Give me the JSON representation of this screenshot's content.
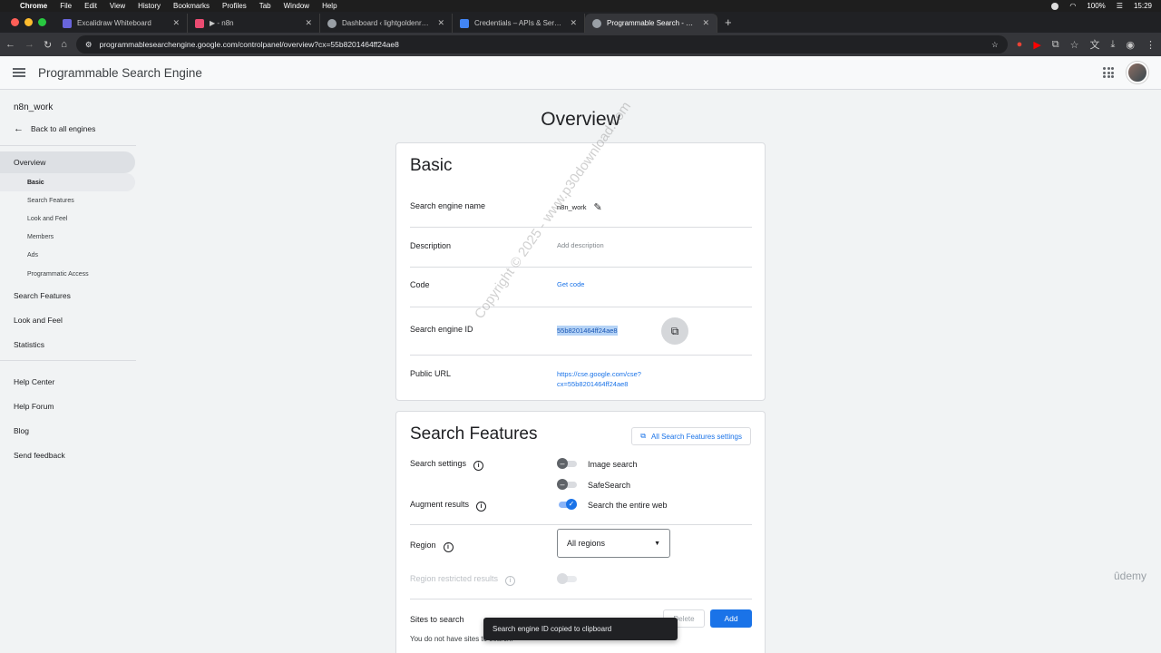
{
  "mac_menu": {
    "app": "Chrome",
    "items": [
      "File",
      "Edit",
      "View",
      "History",
      "Bookmarks",
      "Profiles",
      "Tab",
      "Window",
      "Help"
    ],
    "battery": "100%",
    "clock": "15:29"
  },
  "browser": {
    "tabs": [
      {
        "title": "Excalidraw Whiteboard",
        "favicon_color": "#6965db"
      },
      {
        "title": "▶ - n8n",
        "favicon_color": "#ea4b71"
      },
      {
        "title": "Dashboard ‹ lightgoldenrodye",
        "favicon_color": "#9aa0a6"
      },
      {
        "title": "Credentials – APIs & Services",
        "favicon_color": "#4285f4"
      },
      {
        "title": "Programmable Search - Overv",
        "favicon_color": "#9aa0a6"
      }
    ],
    "url": "programmablesearchengine.google.com/controlpanel/overview?cx=55b8201464ff24ae8"
  },
  "app": {
    "title": "Programmable Search Engine"
  },
  "sidebar": {
    "engine_name": "n8n_work",
    "back_label": "Back to all engines",
    "overview_label": "Overview",
    "sub_items": [
      "Basic",
      "Search Features",
      "Look and Feel",
      "Members",
      "Ads",
      "Programmatic Access"
    ],
    "items": [
      "Search Features",
      "Look and Feel",
      "Statistics"
    ],
    "help_items": [
      "Help Center",
      "Help Forum",
      "Blog",
      "Send feedback"
    ]
  },
  "main": {
    "title": "Overview",
    "basic": {
      "heading": "Basic",
      "name_label": "Search engine name",
      "name_value": "n8n_work",
      "description_label": "Description",
      "description_value": "Add description",
      "code_label": "Code",
      "code_value": "Get code",
      "id_label": "Search engine ID",
      "id_value": "55b8201464ff24ae8",
      "public_url_label": "Public URL",
      "public_url_line1": "https://cse.google.com/cse?",
      "public_url_line2": "cx=55b8201464ff24ae8"
    },
    "features": {
      "heading": "Search Features",
      "all_settings_label": "All Search Features settings",
      "search_settings_label": "Search settings",
      "image_search_label": "Image search",
      "image_search_on": false,
      "safesearch_label": "SafeSearch",
      "safesearch_on": false,
      "augment_label": "Augment results",
      "entire_web_label": "Search the entire web",
      "entire_web_on": true,
      "region_label": "Region",
      "region_value": "All regions",
      "restricted_label": "Region restricted results",
      "sites_label": "Sites to search",
      "delete_label": "Delete",
      "add_label": "Add",
      "no_sites_text": "You do not have sites to search."
    }
  },
  "toast": {
    "text": "Search engine ID copied to clipboard"
  },
  "watermark": "Copyright © 2025 - www.p30download.com",
  "brandmark": "ûdemy"
}
